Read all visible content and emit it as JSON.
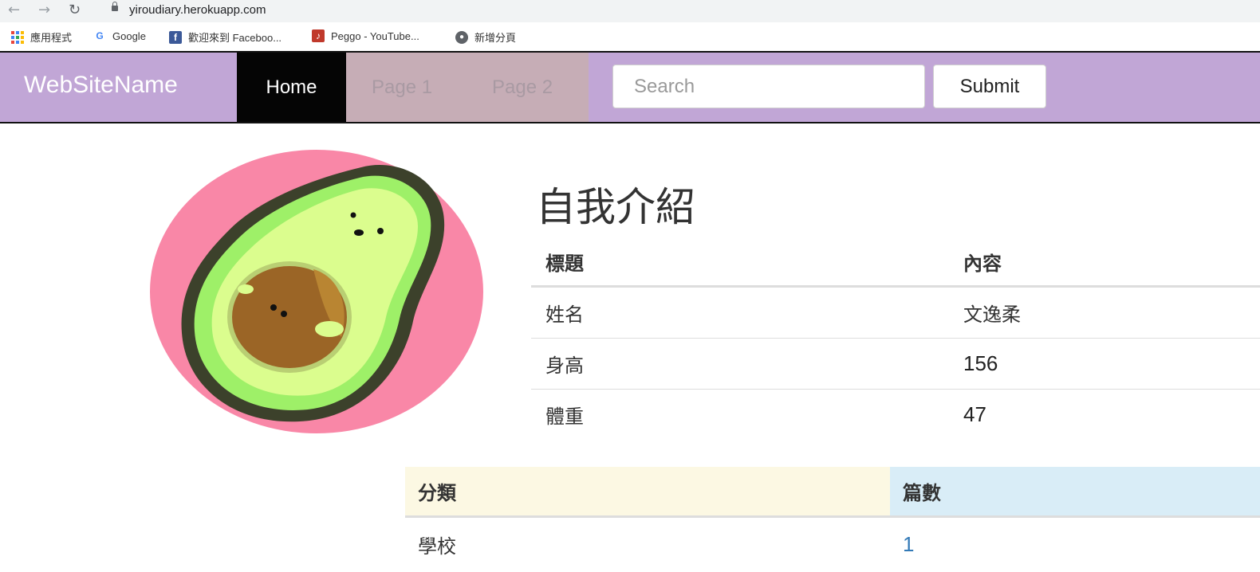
{
  "browser": {
    "url": "yiroudiary.herokuapp.com",
    "bookmarks": [
      {
        "label": "應用程式",
        "icon": "apps-icon"
      },
      {
        "label": "Google",
        "icon": "google-icon"
      },
      {
        "label": "歡迎來到 Faceboo...",
        "icon": "facebook-icon"
      },
      {
        "label": "Peggo - YouTube...",
        "icon": "music-icon"
      },
      {
        "label": "新增分頁",
        "icon": "globe-icon"
      }
    ]
  },
  "navbar": {
    "brand": "WebSiteName",
    "items": [
      "Home",
      "Page 1",
      "Page 2"
    ],
    "active": "Home",
    "search_placeholder": "Search",
    "submit_label": "Submit",
    "background": "#c1a6d6"
  },
  "intro": {
    "title": "自我介紹",
    "headers": [
      "標題",
      "內容"
    ],
    "rows": [
      {
        "label": "姓名",
        "value": "文逸柔"
      },
      {
        "label": "身高",
        "value": "156"
      },
      {
        "label": "體重",
        "value": "47"
      }
    ]
  },
  "categories": {
    "headers": [
      "分類",
      "篇數"
    ],
    "rows": [
      {
        "category": "學校",
        "count": "1"
      }
    ]
  }
}
